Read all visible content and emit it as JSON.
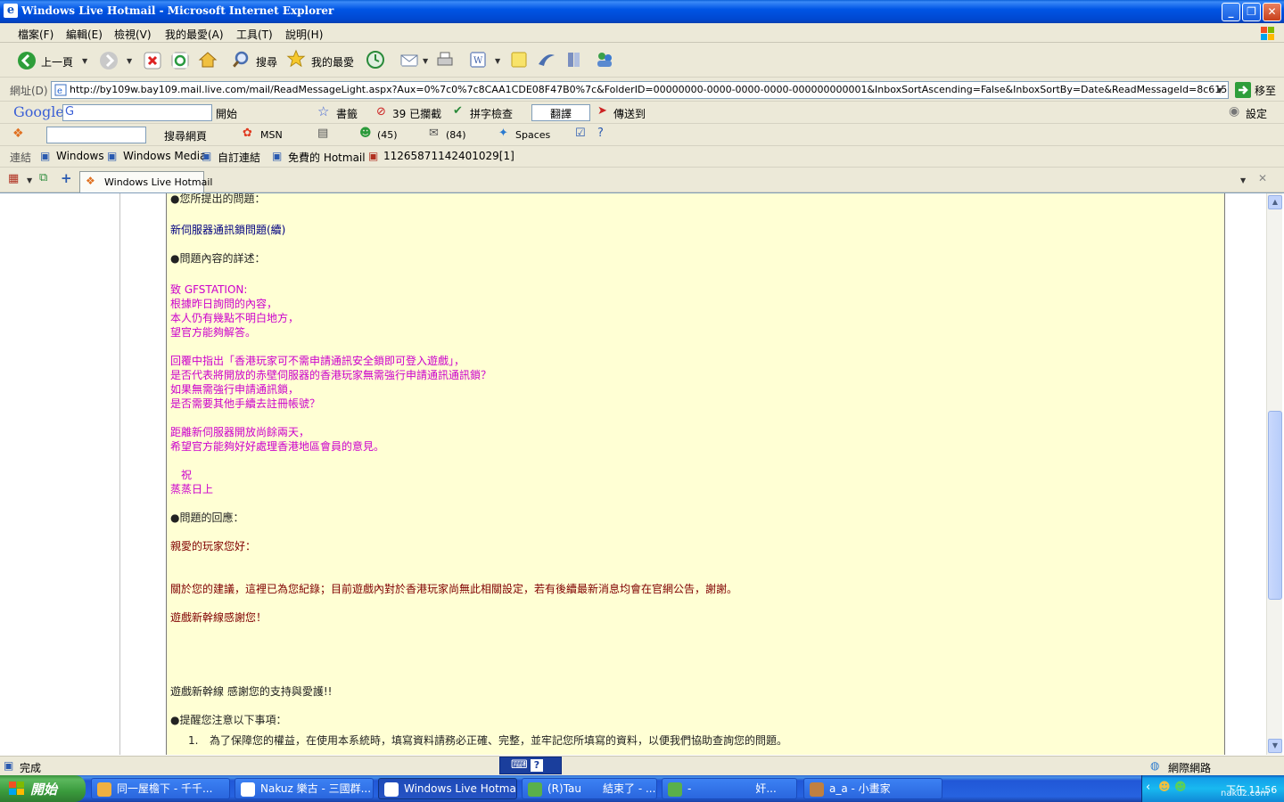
{
  "window": {
    "title": "Windows Live Hotmail - Microsoft Internet Explorer",
    "min": "_",
    "max": "❐",
    "close": "✕"
  },
  "menu": [
    "檔案(F)",
    "編輯(E)",
    "檢視(V)",
    "我的最愛(A)",
    "工具(T)",
    "說明(H)"
  ],
  "toolbar": {
    "back": "上一頁",
    "search": "搜尋",
    "favorites": "我的最愛"
  },
  "address": {
    "label": "網址(D)",
    "url": "http://by109w.bay109.mail.live.com/mail/ReadMessageLight.aspx?Aux=0%7c0%7c8CAA1CDE08F47B0%7c&FolderID=00000000-0000-0000-0000-000000000001&InboxSortAscending=False&InboxSortBy=Date&ReadMessageId=8c6150da-d8db-4c5a-a8f4-cfa9e688e2",
    "go": "移至"
  },
  "google_bar": {
    "logo": "Google",
    "search_prefix": "G",
    "start": "開始",
    "bookmarks": "書籤",
    "blocked": "39 已攔截",
    "spellcheck": "拼字檢查",
    "translate": "翻譯",
    "sendto": "傳送到",
    "settings": "設定"
  },
  "msn_bar": {
    "search_web": "搜尋網頁",
    "msn": "MSN",
    "messenger_count": "(45)",
    "mail_count": "(84)",
    "spaces": "Spaces"
  },
  "links": {
    "label": "連結",
    "items": [
      "Windows",
      "Windows Media",
      "自訂連結",
      "免費的 Hotmail",
      "11265871142401029[1]"
    ]
  },
  "tabs": {
    "active": "Windows Live Hotmail"
  },
  "message": {
    "q_header": "●您所提出的問題：",
    "q_title": "新伺服器通訊鎖問題(續)",
    "detail_header": "●問題內容的詳述：",
    "body": [
      "致 GFSTATION:",
      "根據昨日詢問的內容，",
      "本人仍有幾點不明白地方，",
      "望官方能夠解答。",
      "回覆中指出「香港玩家可不需申請通訊安全鎖即可登入遊戲」，",
      "是否代表將開放的赤壁伺服器的香港玩家無需強行申請通訊通訊鎖？",
      "如果無需強行申請通訊鎖，",
      "是否需要其他手續去註冊帳號？",
      "距離新伺服器開放尚餘兩天，",
      "希望官方能夠好好處理香港地區會員的意見。",
      "　祝",
      "蒸蒸日上"
    ],
    "reply_header": "●問題的回應：",
    "greeting": "親愛的玩家您好：",
    "reply_body": "關於您的建議，這裡已為您紀錄；目前遊戲內對於香港玩家尚無此相關設定，若有後續最新消息均會在官網公告，謝謝。",
    "thanks": "遊戲新幹線感謝您！",
    "support": "遊戲新幹線 感謝您的支持與愛護!!",
    "notice_header": "●提醒您注意以下事項：",
    "notice_1_num": "1.",
    "notice_1": "為了保障您的權益，在使用本系統時，填寫資料請務必正確、完整，並牢記您所填寫的資料，以便我們協助查詢您的問題。"
  },
  "status": {
    "done": "完成",
    "zone": "網際網路"
  },
  "taskbar": {
    "start": "開始",
    "items": [
      "同一屋檐下 - 千千...",
      "Nakuz 樂古 - 三國群...",
      "Windows Live Hotmai...",
      "(R)Tau　　結束了 - ...",
      "-　　　　　　奸...",
      "a_a - 小畫家"
    ],
    "clock": "下午 11:56",
    "watermark": "nakuz.com"
  },
  "colors": {
    "mail_bg": "#ffffd4",
    "pink_text": "#cc00cc",
    "navy_text": "#000080",
    "maroon_text": "#800000"
  }
}
